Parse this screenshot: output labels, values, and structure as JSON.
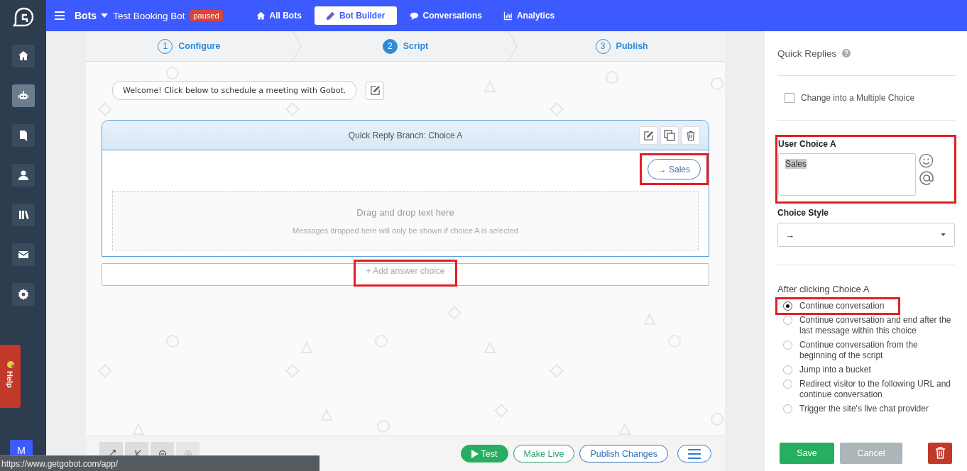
{
  "sidebar": {
    "items": [
      {
        "kind": "home",
        "selected": false
      },
      {
        "kind": "robot",
        "selected": true
      },
      {
        "kind": "document",
        "selected": false
      },
      {
        "kind": "person",
        "selected": false
      },
      {
        "kind": "library",
        "selected": false
      },
      {
        "kind": "mail",
        "selected": false
      },
      {
        "kind": "settings",
        "selected": false
      }
    ],
    "help_tab": {
      "label": "Help"
    },
    "avatar": {
      "initial": "M"
    }
  },
  "topbar": {
    "bots_label": "Bots",
    "bot_name": "Test Booking Bot",
    "status_badge": "paused",
    "nav": [
      {
        "label": "All Bots",
        "kind": "home",
        "selected": false
      },
      {
        "label": "Bot Builder",
        "kind": "pencil",
        "selected": true
      },
      {
        "label": "Conversations",
        "kind": "chat",
        "selected": false
      },
      {
        "label": "Analytics",
        "kind": "chart",
        "selected": false
      }
    ]
  },
  "steps": [
    {
      "number": "1",
      "label": "Configure",
      "selected": false
    },
    {
      "number": "2",
      "label": "Script",
      "selected": true
    },
    {
      "number": "3",
      "label": "Publish",
      "selected": false
    }
  ],
  "welcome_message": "Welcome! Click below to schedule a meeting with Gobot.",
  "branch": {
    "title": "Quick Reply Branch: Choice A",
    "choice_button": {
      "label": "→ Sales",
      "highlighted": true
    },
    "drop_zone": {
      "title": "Drag and drop text here",
      "hint": "Messages dropped here will only be shown if choice A is selected"
    }
  },
  "add_choice": {
    "label": "+ Add answer choice",
    "highlighted": true
  },
  "toolbar": {
    "tools": [
      {
        "kind": "expand",
        "disabled": false
      },
      {
        "kind": "compress",
        "disabled": false
      },
      {
        "kind": "zoom-out",
        "disabled": false
      },
      {
        "kind": "zoom-in",
        "disabled": true
      }
    ],
    "actions": [
      {
        "kind": "play",
        "label": "Test"
      },
      {
        "kind": "outline",
        "label": "Make Live"
      },
      {
        "kind": "outline",
        "label": "Publish Changes"
      },
      {
        "kind": "menu"
      }
    ]
  },
  "panel": {
    "title": "Quick Replies",
    "multiple_choice": {
      "label": "Change into a Multiple Choice",
      "checked": false
    },
    "user_choice": {
      "label": "User Choice A",
      "value": "Sales",
      "highlighted": true
    },
    "choice_style": {
      "label": "Choice Style",
      "value": "→"
    },
    "after_click": {
      "label": "After clicking Choice A",
      "options": [
        {
          "label": "Continue conversation",
          "selected": true,
          "highlighted": true
        },
        {
          "label": "Continue conversation and end after the last message within this choice",
          "selected": false,
          "highlighted": false
        },
        {
          "label": "Continue conversation from the beginning of the script",
          "selected": false,
          "highlighted": false
        },
        {
          "label": "Jump into a bucket",
          "selected": false,
          "highlighted": false
        },
        {
          "label": "Redirect visitor to the following URL and continue conversation",
          "selected": false,
          "highlighted": false
        },
        {
          "label": "Trigger the site's live chat provider",
          "selected": false,
          "highlighted": false
        }
      ]
    },
    "buttons": [
      {
        "kind": "save",
        "label": "Save"
      },
      {
        "kind": "cancel",
        "label": "Cancel"
      },
      {
        "kind": "delete"
      }
    ]
  },
  "status_url": "https://www.getgobot.com/app/"
}
